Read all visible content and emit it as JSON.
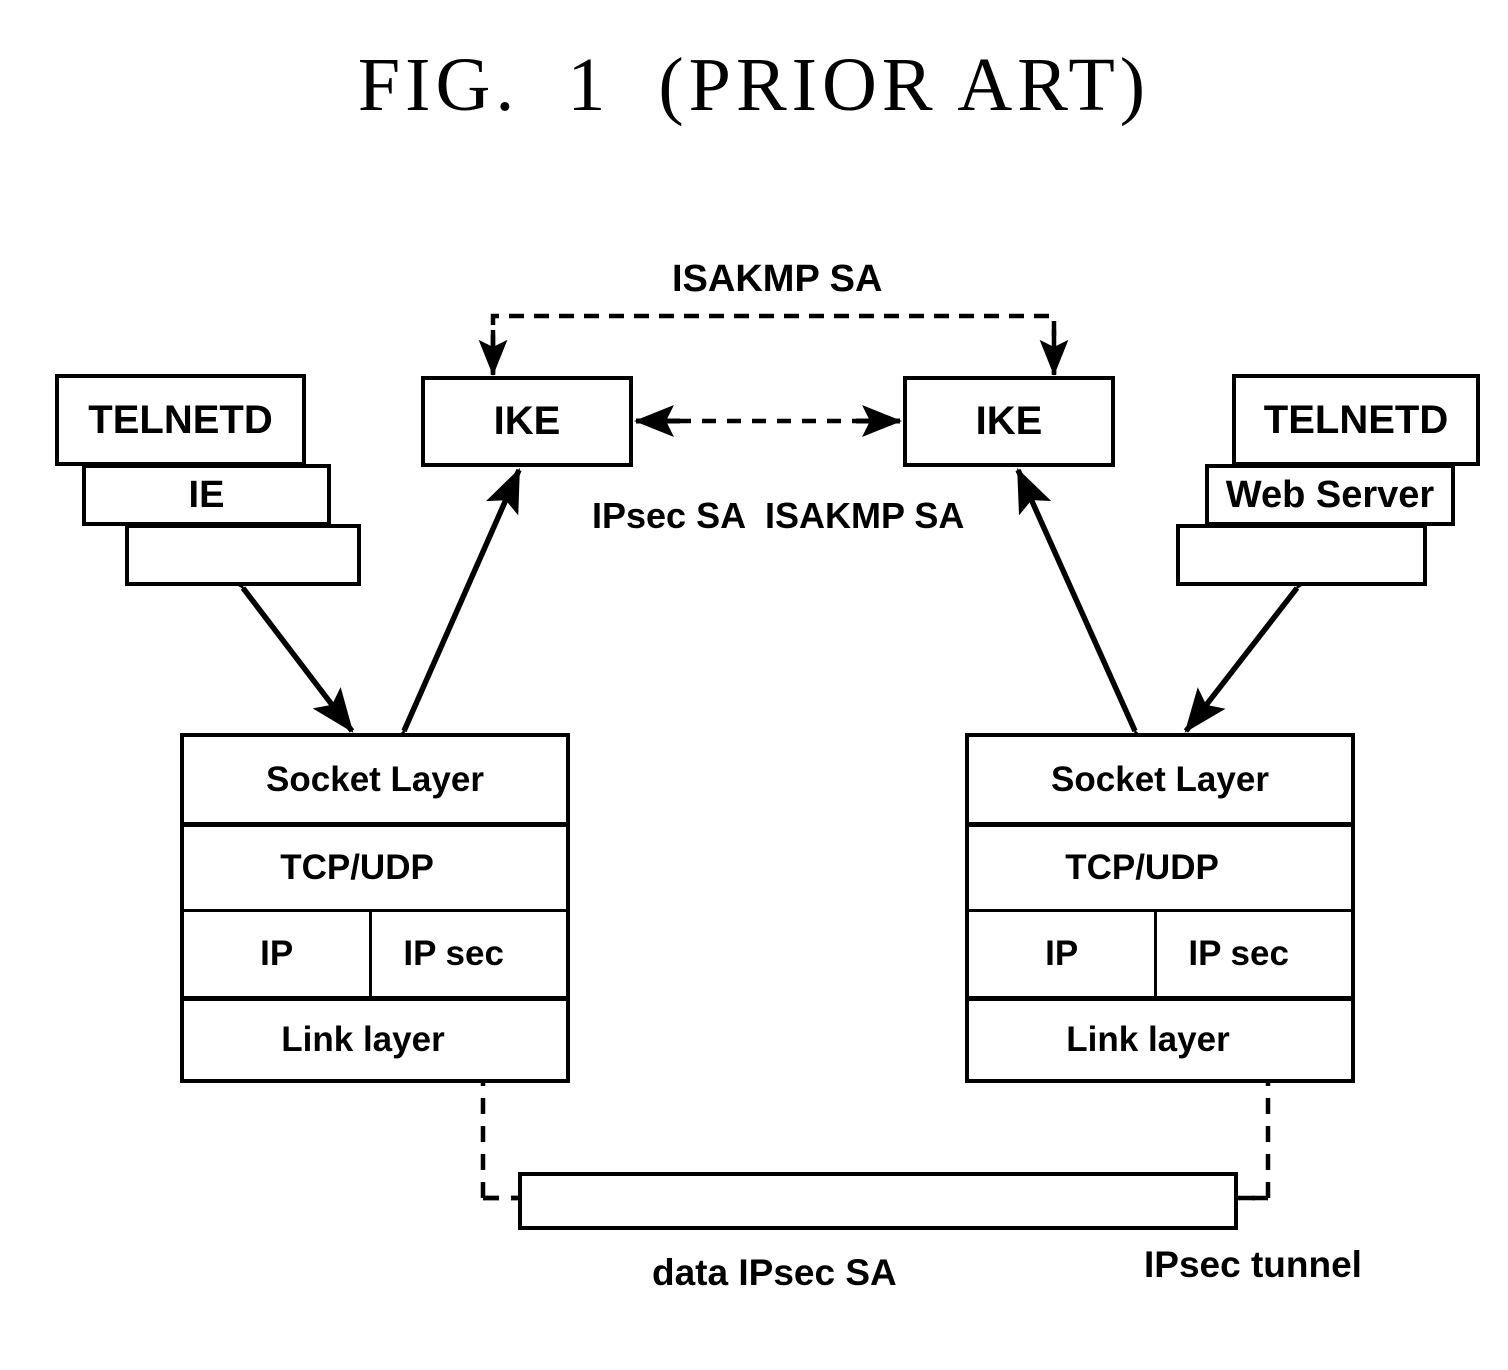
{
  "figure": {
    "title": "FIG.  1  (PRIOR ART)"
  },
  "labels": {
    "isakmp_sa_top": "ISAKMP SA",
    "ipsec_sa_mid": "IPsec SA",
    "isakmp_sa_mid": "ISAKMP SA",
    "data_ipsec_sa": "data   IPsec SA",
    "ipsec_tunnel": "IPsec tunnel"
  },
  "left_host": {
    "app_boxes": [
      {
        "label": "TELNETD"
      },
      {
        "label": "IE"
      },
      {
        "label": ""
      }
    ],
    "ike": {
      "label": "IKE"
    },
    "stack": {
      "rows": [
        {
          "label": "Socket Layer"
        },
        {
          "label": "TCP/UDP"
        },
        {
          "label_left": "IP",
          "label_right": "IP sec"
        },
        {
          "label": "Link layer"
        }
      ]
    }
  },
  "right_host": {
    "app_boxes": [
      {
        "label": "TELNETD"
      },
      {
        "label": "Web Server"
      },
      {
        "label": ""
      }
    ],
    "ike": {
      "label": "IKE"
    },
    "stack": {
      "rows": [
        {
          "label": "Socket Layer"
        },
        {
          "label": "TCP/UDP"
        },
        {
          "label_left": "IP",
          "label_right": "IP sec"
        },
        {
          "label": "Link layer"
        }
      ]
    }
  },
  "colors": {
    "stroke": "#000000",
    "background": "#ffffff"
  }
}
